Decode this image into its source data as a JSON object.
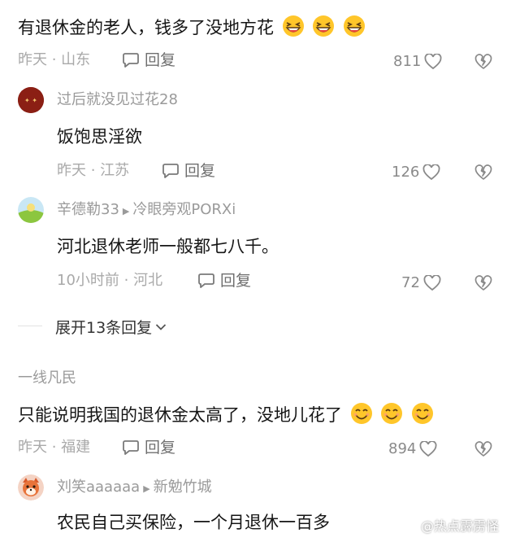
{
  "comments": [
    {
      "text": "有退休金的老人，钱多了没地方花",
      "time_location": "昨天 · 山东",
      "reply_label": "回复",
      "likes": "811",
      "emoji": "grinning-squint-emoji"
    },
    {
      "username": "过后就没见过花28",
      "text": "饭饱思淫欲",
      "time_location": "昨天 · 江苏",
      "reply_label": "回复",
      "likes": "126"
    },
    {
      "username": "辛德勒33",
      "reply_to": "冷眼旁观PORXi",
      "text": "河北退休老师一般都七八千。",
      "time_location": "10小时前 · 河北",
      "reply_label": "回复",
      "likes": "72"
    },
    {
      "username": "一线凡民",
      "text": "只能说明我国的退休金太高了，没地儿花了",
      "time_location": "昨天 · 福建",
      "reply_label": "回复",
      "likes": "894",
      "emoji": "smile-emoji"
    },
    {
      "username": "刘笑aaaaaa",
      "reply_to": "新勉竹城",
      "text": "农民自己买保险，一个月退休一百多"
    }
  ],
  "expand_replies": "展开13条回复",
  "watermark": "@热点霹雳怪",
  "colors": {
    "meta_gray": "#a9a9a9",
    "emoji_yellow": "#ffc62a",
    "emoji_red": "#e8453c"
  }
}
